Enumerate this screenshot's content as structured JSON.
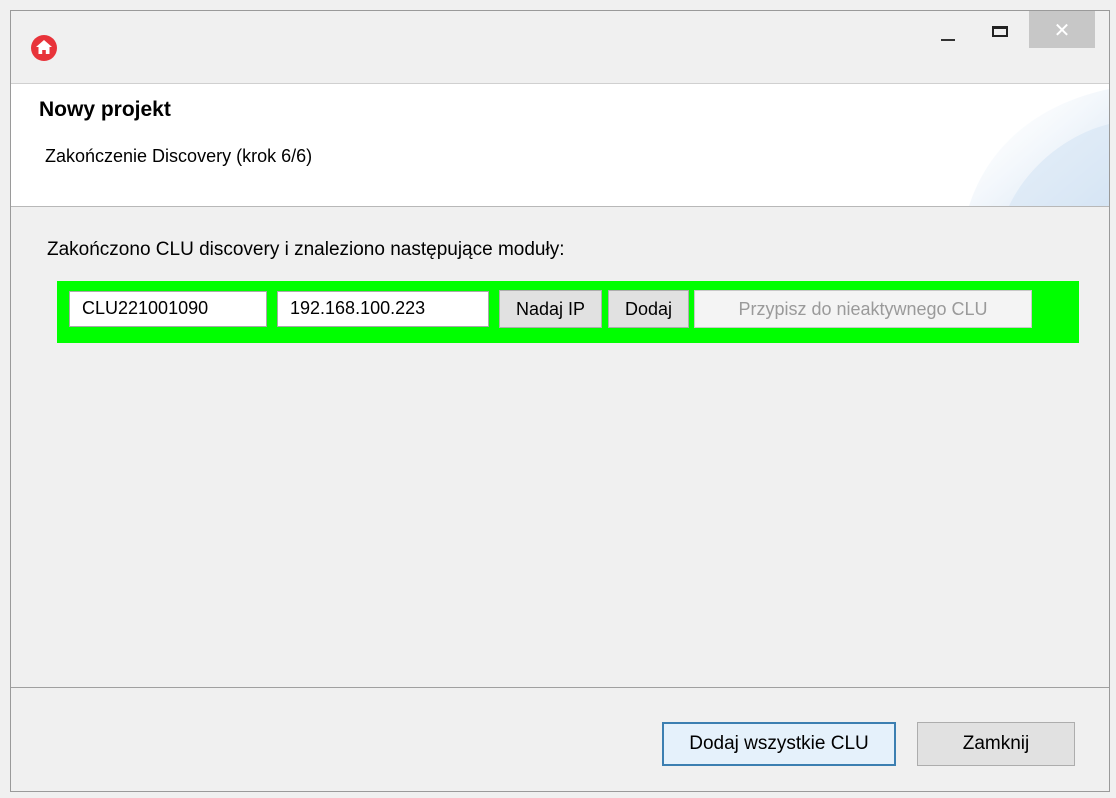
{
  "window": {
    "app_icon": "home-icon",
    "controls": {
      "minimize": "minimize-icon",
      "maximize": "maximize-icon",
      "close": "close-icon",
      "close_glyph": "✕"
    }
  },
  "header": {
    "title": "Nowy projekt",
    "subtitle": "Zakończenie Discovery (krok 6/6)"
  },
  "body": {
    "message": "Zakończono CLU discovery i znaleziono następujące moduły:",
    "modules": [
      {
        "name": "CLU221001090",
        "ip": "192.168.100.223",
        "assign_ip_label": "Nadaj IP",
        "add_label": "Dodaj",
        "assign_inactive_label": "Przypisz do nieaktywnego CLU",
        "row_color": "#00ff00"
      }
    ]
  },
  "footer": {
    "add_all_label": "Dodaj wszystkie CLU",
    "close_label": "Zamknij"
  },
  "colors": {
    "accent": "#3c7fb1",
    "app_icon_red": "#e8333a",
    "row_highlight": "#00ff00"
  }
}
